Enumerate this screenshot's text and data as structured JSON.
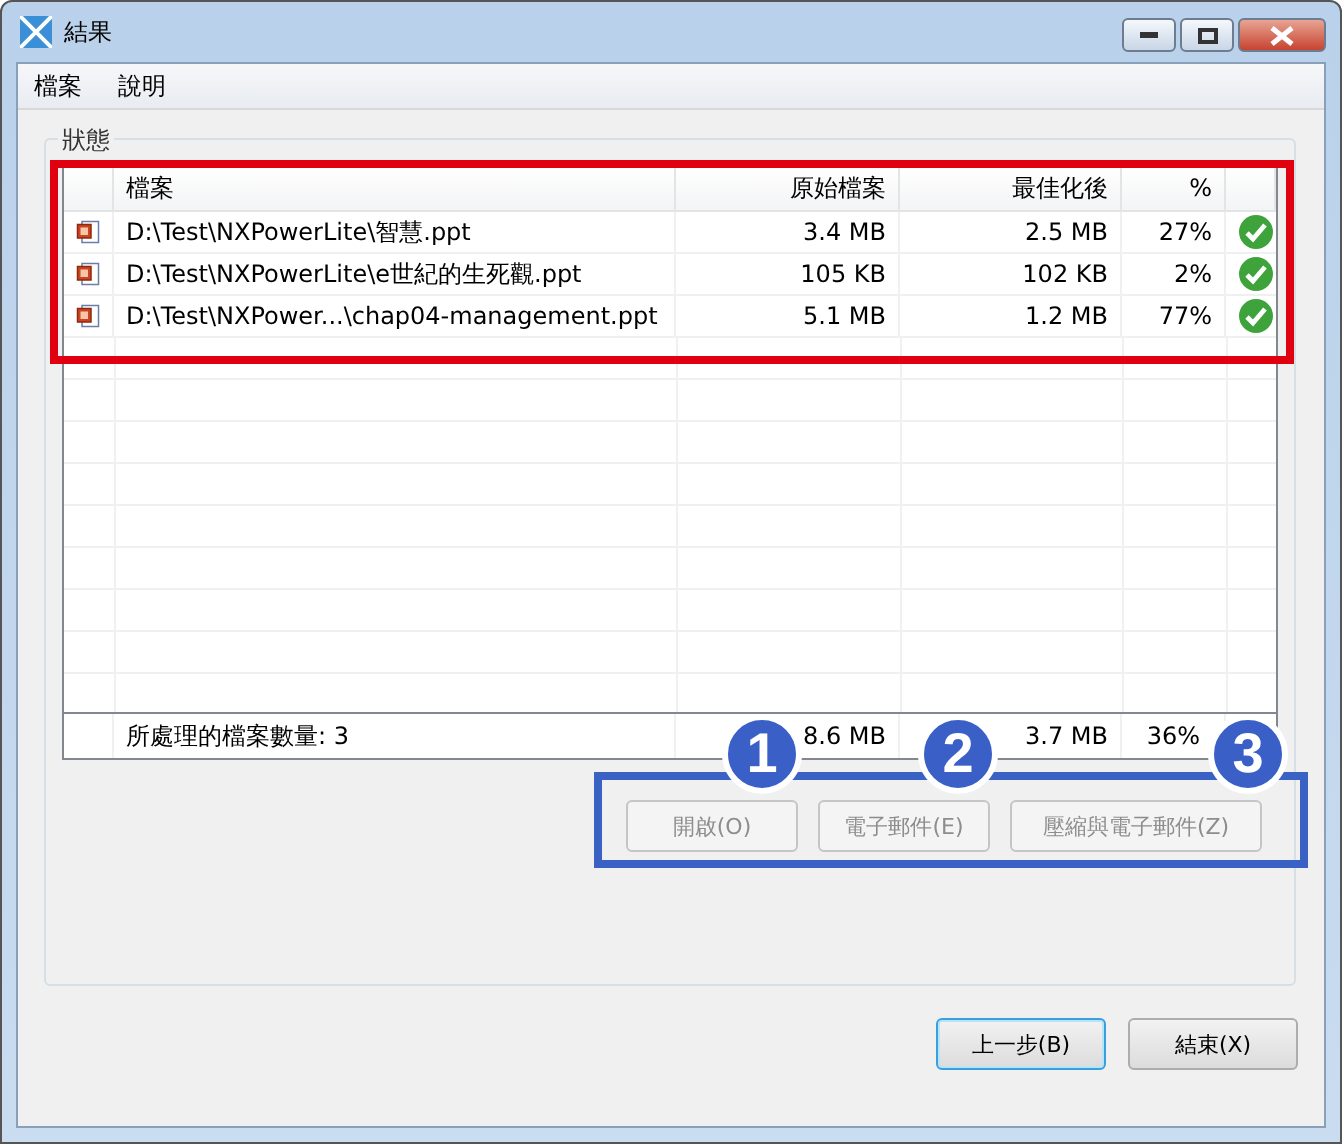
{
  "window": {
    "title": "結果"
  },
  "menu": [
    "檔案",
    "說明"
  ],
  "group": {
    "title": "狀態"
  },
  "table": {
    "columns": [
      "檔案",
      "原始檔案",
      "最佳化後",
      "%"
    ],
    "rows": [
      {
        "file": "D:\\Test\\NXPowerLite\\智慧.ppt",
        "original": "3.4 MB",
        "optimized": "2.5 MB",
        "percent": "27%",
        "done": true
      },
      {
        "file": "D:\\Test\\NXPowerLite\\e世紀的生死觀.ppt",
        "original": "105 KB",
        "optimized": "102 KB",
        "percent": "2%",
        "done": true
      },
      {
        "file": "D:\\Test\\NXPower...\\chap04-management.ppt",
        "original": "5.1 MB",
        "optimized": "1.2 MB",
        "percent": "77%",
        "done": true
      }
    ],
    "footer": {
      "label": "所處理的檔案數量: 3",
      "original": "8.6 MB",
      "optimized": "3.7 MB",
      "percent": "36%"
    }
  },
  "actions": [
    {
      "label": "開啟(O)",
      "disabled": true,
      "badge": "1"
    },
    {
      "label": "電子郵件(E)",
      "disabled": true,
      "badge": "2"
    },
    {
      "label": "壓縮與電子郵件(Z)",
      "disabled": true,
      "badge": "3"
    }
  ],
  "buttons": [
    {
      "label": "上一步(B)",
      "default": true
    },
    {
      "label": "結束(X)",
      "default": false
    }
  ]
}
